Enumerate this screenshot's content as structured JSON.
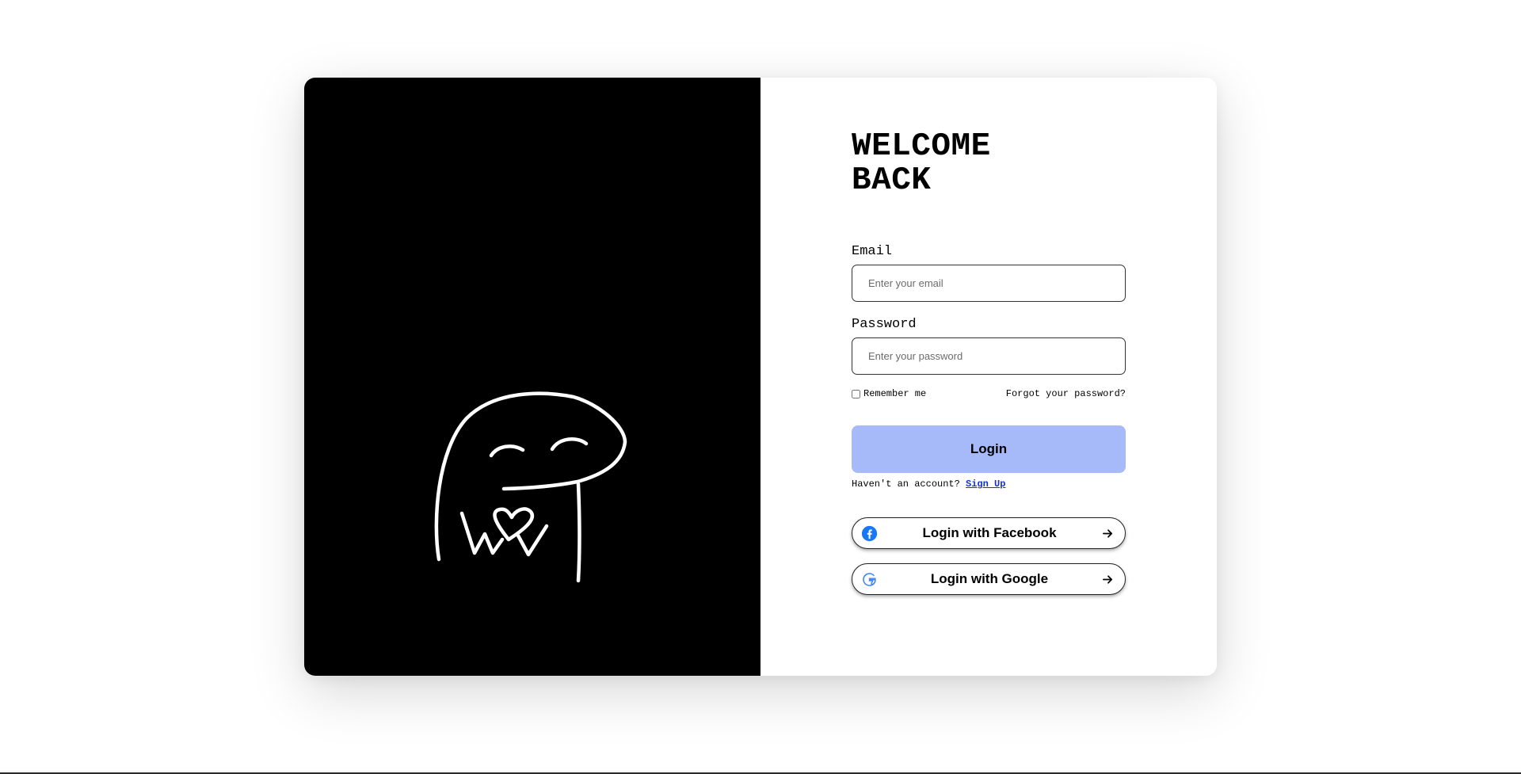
{
  "heading": {
    "line1": "WELCOME",
    "line2": "BACK"
  },
  "email": {
    "label": "Email",
    "placeholder": "Enter your email",
    "value": ""
  },
  "password": {
    "label": "Password",
    "placeholder": "Enter your password",
    "value": ""
  },
  "options": {
    "remember_label": "Remember me",
    "remember_checked": false,
    "forgot_label": "Forgot your password?"
  },
  "login": {
    "label": "Login"
  },
  "signup": {
    "prompt": "Haven't an account?",
    "link_label": "Sign Up"
  },
  "social": {
    "facebook_label": "Login with Facebook",
    "facebook_icon": "facebook-icon",
    "google_label": "Login with Google",
    "google_icon": "google-icon",
    "arrow_icon": "arrow-right-icon"
  },
  "colors": {
    "art_background": "#000000",
    "login_button": "#a6b9f9",
    "signup_link": "#1a2fd1",
    "facebook_blue": "#1877f2",
    "google_blue": "#4285f4"
  }
}
